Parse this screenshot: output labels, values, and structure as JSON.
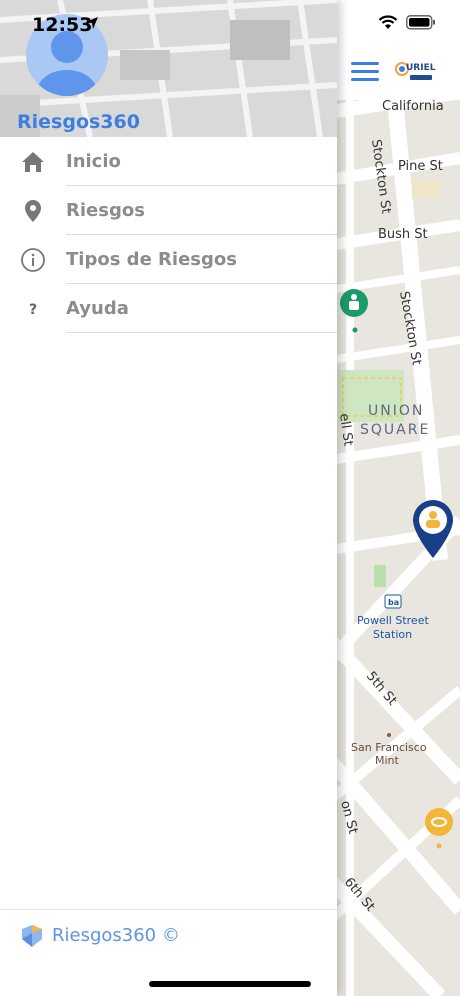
{
  "status_bar": {
    "time": "12:53"
  },
  "drawer": {
    "app_name": "Riesgos360",
    "menu": [
      {
        "label": "Inicio",
        "icon": "home-icon"
      },
      {
        "label": "Riesgos",
        "icon": "location-pin-icon"
      },
      {
        "label": "Tipos de Riesgos",
        "icon": "info-icon"
      },
      {
        "label": "Ayuda",
        "icon": "question-icon"
      }
    ],
    "footer_text": "Riesgos360 ©"
  },
  "header": {
    "brand": "URIEL"
  },
  "map": {
    "streets": [
      "California",
      "Pine St",
      "Bush St",
      "Stockton St",
      "Stockton St",
      "5th St",
      "6th St",
      "on St",
      "ell St"
    ],
    "area_label_line1": "UNION",
    "area_label_line2": "SQUARE",
    "poi": [
      {
        "label_line1": "Powell Street",
        "label_line2": "Station"
      },
      {
        "label_line1": "San Francisco",
        "label_line2": "Mint"
      }
    ]
  },
  "colors": {
    "accent": "#3f7de6",
    "app_name": "#3d7fe0",
    "menu_text": "#8c8c8c",
    "map_bg": "#e9e6df",
    "marker_navy": "#1a3f8a",
    "marker_green": "#1d9a6c",
    "marker_yellow": "#f4b63a"
  }
}
